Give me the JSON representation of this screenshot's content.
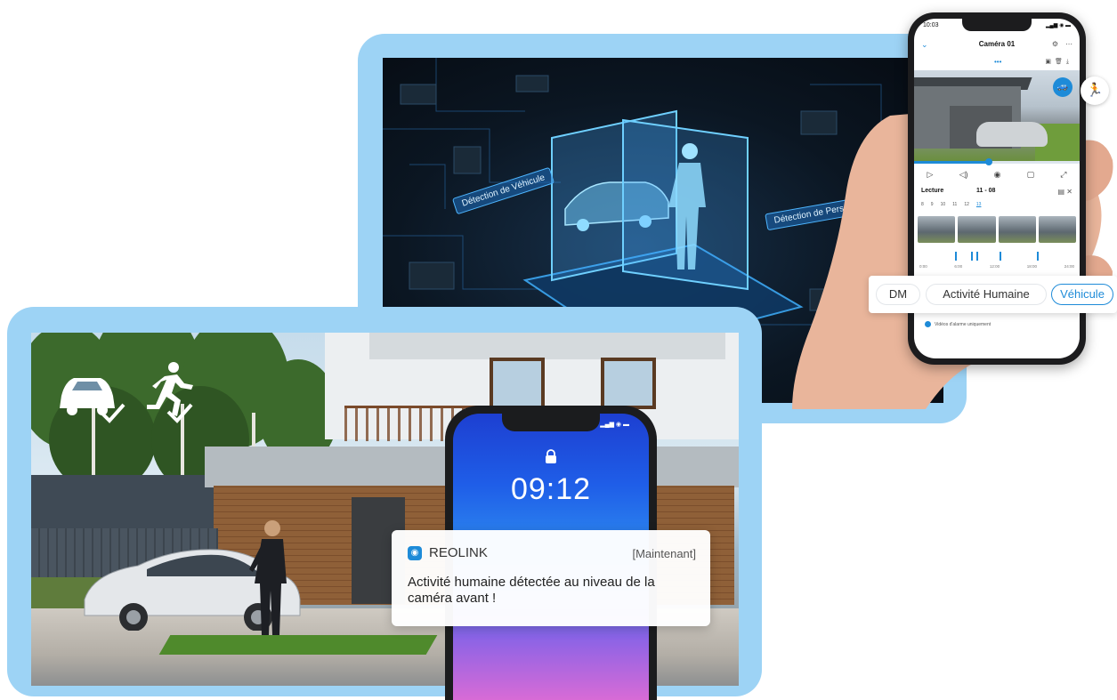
{
  "top_panel": {
    "tags": {
      "vehicle": "Détection de Véhicule",
      "person": "Détection de Personne"
    }
  },
  "app_phone": {
    "status_time": "10:03",
    "title": "Caméra 01",
    "lecture_label": "Lecture",
    "lecture_date": "11 - 08",
    "days": [
      "8",
      "9",
      "10",
      "11",
      "12",
      "13"
    ],
    "timeline_times": [
      "0:00",
      "6:00",
      "12:00",
      "18:00",
      "24:00"
    ],
    "alarm_text": "Vidéos d'alarme uniquement"
  },
  "filters": {
    "dm": "DM",
    "activity": "Activité Humaine",
    "vehicle": "Véhicule"
  },
  "lock_phone": {
    "time": "09:12"
  },
  "notification": {
    "app_name": "REOLINK",
    "time": "[Maintenant]",
    "message": "Activité humaine détectée au niveau de la caméra avant !"
  },
  "colors": {
    "frame_blue": "#9dd3f5",
    "accent": "#1e8bd8"
  }
}
